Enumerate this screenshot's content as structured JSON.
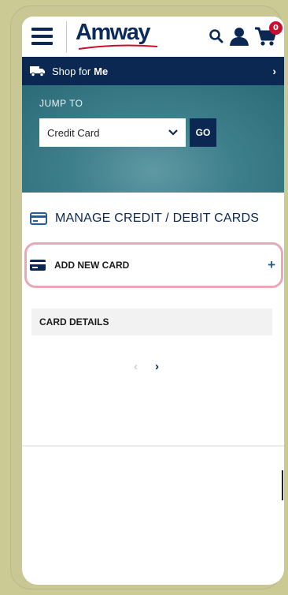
{
  "header": {
    "logo_text": "Amway",
    "cart_count": "0",
    "icons": [
      "menu-icon",
      "search-icon",
      "account-icon",
      "cart-icon"
    ]
  },
  "shop_bar": {
    "prefix": "Shop for",
    "who": "Me",
    "chevron": "›"
  },
  "jump_to": {
    "label": "JUMP TO",
    "selected_option": "Credit Card",
    "go_label": "GO"
  },
  "manage": {
    "title": "MANAGE CREDIT / DEBIT CARDS"
  },
  "add_card": {
    "label": "ADD NEW CARD",
    "plus": "+"
  },
  "card_details": {
    "header": "CARD DETAILS"
  },
  "pager": {
    "prev": "‹",
    "next": "›"
  },
  "colors": {
    "brand_navy": "#0b2852",
    "teal_hero": "#3d7f8b",
    "cart_badge": "#c8102e",
    "highlight_outline": "#e8a8b6",
    "frame": "#ccca94"
  }
}
